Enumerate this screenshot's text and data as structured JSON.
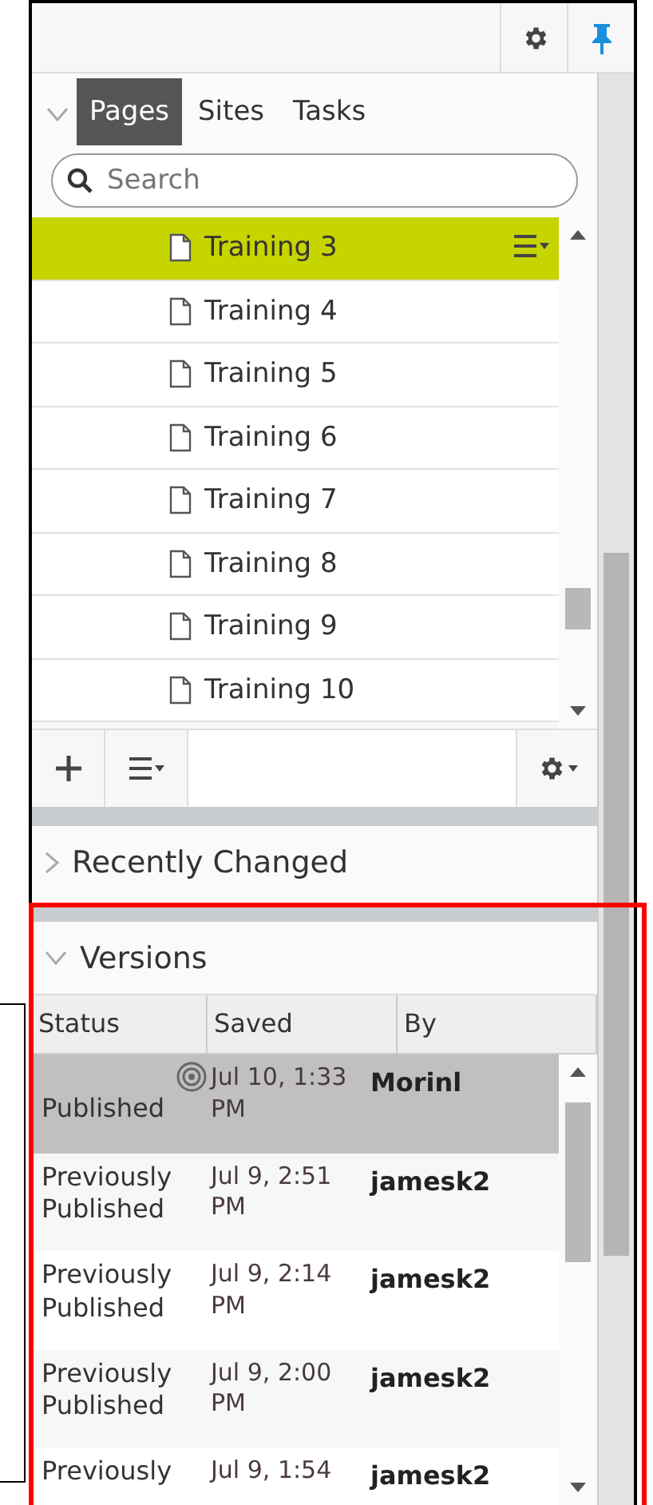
{
  "tabs": [
    {
      "label": "Pages",
      "selected": true
    },
    {
      "label": "Sites",
      "selected": false
    },
    {
      "label": "Tasks",
      "selected": false
    }
  ],
  "search": {
    "placeholder": "Search"
  },
  "tree": [
    {
      "label": "Training 3",
      "selected": true
    },
    {
      "label": "Training 4",
      "selected": false
    },
    {
      "label": "Training 5",
      "selected": false
    },
    {
      "label": "Training 6",
      "selected": false
    },
    {
      "label": "Training 7",
      "selected": false
    },
    {
      "label": "Training 8",
      "selected": false
    },
    {
      "label": "Training 9",
      "selected": false
    },
    {
      "label": "Training 10",
      "selected": false
    }
  ],
  "sections": [
    {
      "title": "Recently Changed",
      "expanded": false
    },
    {
      "title": "Versions",
      "expanded": true
    }
  ],
  "versions": {
    "columns": [
      "Status",
      "Saved",
      "By"
    ],
    "rows": [
      {
        "status": "Published",
        "saved": "Jul 10, 1:33 PM",
        "by": "Morinl",
        "selected": true,
        "current": true
      },
      {
        "status": "Previously Published",
        "saved": "Jul 9, 2:51 PM",
        "by": "jamesk2",
        "selected": false,
        "current": false
      },
      {
        "status": "Previously Published",
        "saved": "Jul 9, 2:14 PM",
        "by": "jamesk2",
        "selected": false,
        "current": false
      },
      {
        "status": "Previously Published",
        "saved": "Jul 9, 2:00 PM",
        "by": "jamesk2",
        "selected": false,
        "current": false
      },
      {
        "status": "Previously",
        "saved": "Jul 9, 1:54",
        "by": "jamesk2",
        "selected": false,
        "current": false
      }
    ]
  }
}
